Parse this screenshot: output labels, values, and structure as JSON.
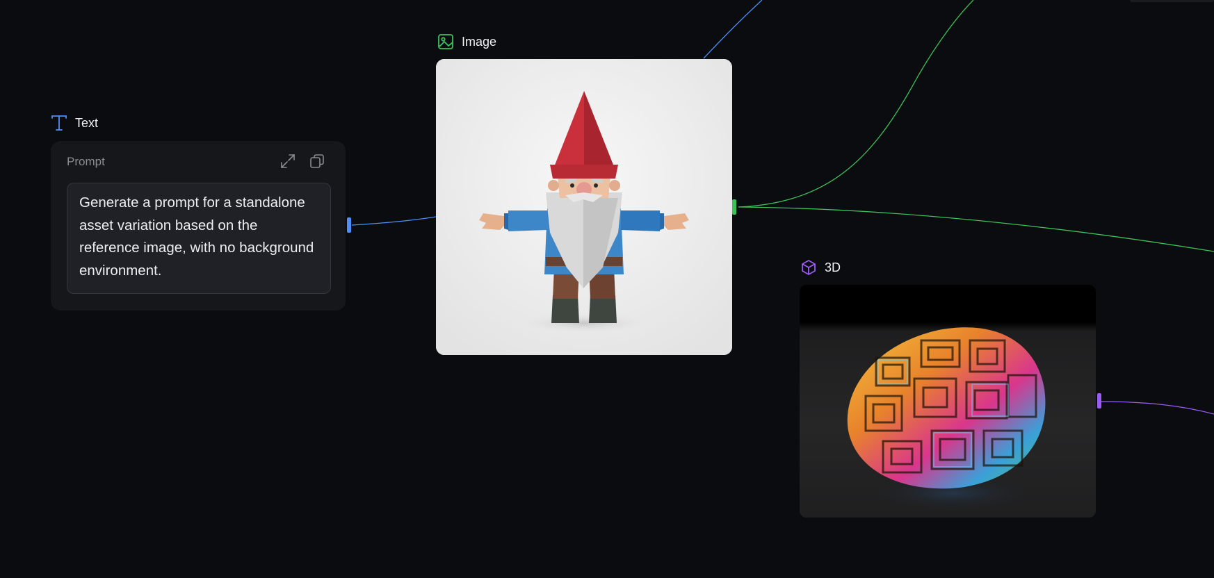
{
  "nodes": {
    "text": {
      "title": "Text",
      "field_label": "Prompt",
      "prompt": "Generate a prompt for a standalone asset variation based on the reference image, with no background environment."
    },
    "image": {
      "title": "Image"
    },
    "model3d": {
      "title": "3D"
    }
  },
  "icons": {
    "text": "text-type-icon",
    "image": "image-icon",
    "model3d": "cube-icon",
    "expand": "expand-icon",
    "copy": "copy-icon"
  },
  "colors": {
    "background": "#0a0c0f",
    "text_accent": "#4f8ff7",
    "image_accent": "#3ec15a",
    "model3d_accent": "#9b5cf6"
  }
}
